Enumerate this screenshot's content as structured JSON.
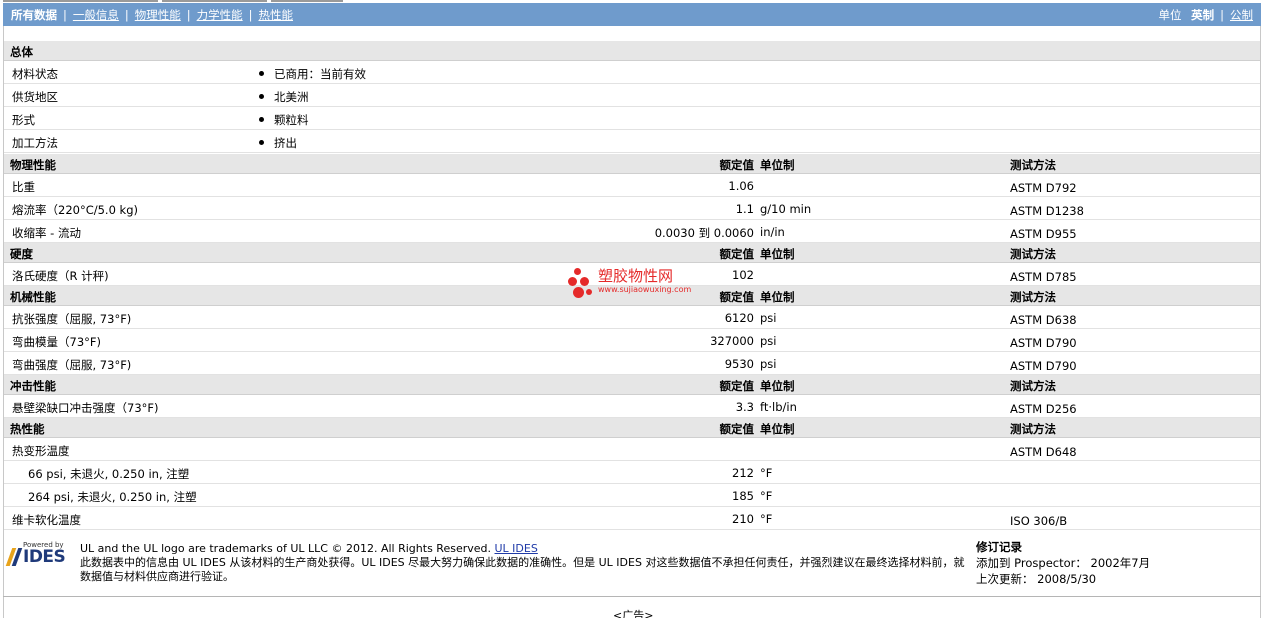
{
  "nav": {
    "tabs": [
      "所有数据",
      "一般信息",
      "物理性能",
      "力学性能",
      "热性能"
    ],
    "selected_index": 0,
    "units_label": "单位",
    "unit_english": "英制",
    "unit_metric": "公制"
  },
  "col_headers": {
    "value": "额定值",
    "unit": "单位制",
    "method": "测试方法"
  },
  "general": {
    "title": "总体",
    "rows": [
      {
        "name": "材料状态",
        "value": "已商用：当前有效"
      },
      {
        "name": "供货地区",
        "value": "北美洲"
      },
      {
        "name": "形式",
        "value": "颗粒料"
      },
      {
        "name": "加工方法",
        "value": "挤出"
      }
    ]
  },
  "physical": {
    "title": "物理性能",
    "rows": [
      {
        "name": "比重",
        "value": "1.06",
        "unit": "",
        "method": "ASTM D792"
      },
      {
        "name": "熔流率（220°C/5.0 kg)",
        "value": "1.1",
        "unit": "g/10 min",
        "method": "ASTM D1238"
      },
      {
        "name": "收缩率 - 流动",
        "value": "0.0030 到  0.0060",
        "unit": "in/in",
        "method": "ASTM D955"
      }
    ]
  },
  "hardness": {
    "title": "硬度",
    "rows": [
      {
        "name": "洛氏硬度（R 计秤)",
        "value": "102",
        "unit": "",
        "method": "ASTM D785"
      }
    ]
  },
  "mechanical": {
    "title": "机械性能",
    "rows": [
      {
        "name": "抗张强度（屈服, 73°F)",
        "value": "6120",
        "unit": "psi",
        "method": "ASTM D638"
      },
      {
        "name": "弯曲模量（73°F)",
        "value": "327000",
        "unit": "psi",
        "method": "ASTM D790"
      },
      {
        "name": "弯曲强度（屈服, 73°F)",
        "value": "9530",
        "unit": "psi",
        "method": "ASTM D790"
      }
    ]
  },
  "impact": {
    "title": "冲击性能",
    "rows": [
      {
        "name": "悬壁梁缺口冲击强度（73°F)",
        "value": "3.3",
        "unit": "ft·lb/in",
        "method": "ASTM D256"
      }
    ]
  },
  "thermal": {
    "title": "热性能",
    "rows": [
      {
        "name": "热变形温度",
        "value": "",
        "unit": "",
        "method": "ASTM D648"
      },
      {
        "name": "66 psi, 未退火, 0.250 in, 注塑",
        "value": "212",
        "unit": "°F",
        "method": ""
      },
      {
        "name": "264 psi, 未退火, 0.250 in, 注塑",
        "value": "185",
        "unit": "°F",
        "method": ""
      },
      {
        "name": "维卡软化温度",
        "value": "210",
        "unit": "°F",
        "method": "ISO 306/B"
      }
    ]
  },
  "watermark": {
    "title": "塑胶物性网",
    "url": "www.sujiaowuxing.com"
  },
  "footer": {
    "logo_powered": "Powered by",
    "logo_name": "IDES",
    "trademark": "UL and the UL logo are trademarks of UL LLC © 2012. All Rights Reserved.",
    "link": "UL IDES",
    "disclaimer": "此数据表中的信息由  UL IDES 从该材料的生产商处获得。UL IDES 尽最大努力确保此数据的准确性。但是  UL IDES 对这些数据值不承担任何责任，并强烈建议在最终选择材料前，就数据值与材料供应商进行验证。",
    "revision_title": "修订记录",
    "added_label": "添加到  Prospector：",
    "added_value": "2002年7月",
    "updated_label": "上次更新：",
    "updated_value": "2008/5/30"
  },
  "ad_label": "<广告>",
  "colors": {
    "nav_bg": "#6f9bcc",
    "header_bg": "#e6e6e6",
    "watermark": "#e52a2a",
    "ides_blue": "#1f3a7a"
  }
}
